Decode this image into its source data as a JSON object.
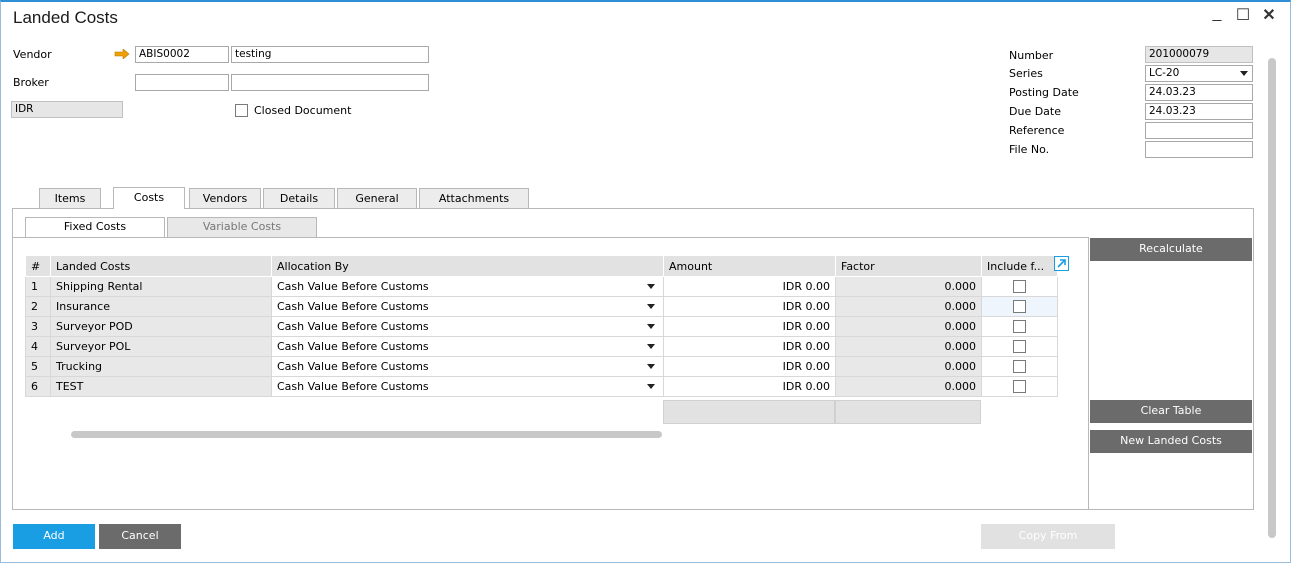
{
  "window": {
    "title": "Landed Costs",
    "minimize": "_",
    "maximize": "☐",
    "close": "✕"
  },
  "header": {
    "vendor_label": "Vendor",
    "vendor_code": "ABIS0002",
    "vendor_name": "testing",
    "broker_label": "Broker",
    "broker_code": "",
    "broker_name": "",
    "currency": "IDR",
    "closed_document_label": "Closed Document",
    "closed_document_checked": false
  },
  "right_fields": {
    "number_label": "Number",
    "number_value": "201000079",
    "series_label": "Series",
    "series_value": "LC-20",
    "posting_date_label": "Posting Date",
    "posting_date_value": "24.03.23",
    "due_date_label": "Due Date",
    "due_date_value": "24.03.23",
    "reference_label": "Reference",
    "reference_value": "",
    "file_no_label": "File No.",
    "file_no_value": ""
  },
  "tabs": [
    "Items",
    "Costs",
    "Vendors",
    "Details",
    "General",
    "Attachments"
  ],
  "active_tab": "Costs",
  "subtabs": [
    "Fixed Costs",
    "Variable Costs"
  ],
  "active_subtab": "Fixed Costs",
  "grid": {
    "headers": [
      "#",
      "Landed Costs",
      "Allocation By",
      "Amount",
      "Factor",
      "Include f..."
    ],
    "rows": [
      {
        "num": "1",
        "name": "Shipping Rental",
        "alloc": "Cash Value Before Customs",
        "amount": "IDR 0.00",
        "factor": "0.000",
        "include": false
      },
      {
        "num": "2",
        "name": "Insurance",
        "alloc": "Cash Value Before Customs",
        "amount": "IDR 0.00",
        "factor": "0.000",
        "include": false
      },
      {
        "num": "3",
        "name": "Surveyor POD",
        "alloc": "Cash Value Before Customs",
        "amount": "IDR 0.00",
        "factor": "0.000",
        "include": false
      },
      {
        "num": "4",
        "name": "Surveyor POL",
        "alloc": "Cash Value Before Customs",
        "amount": "IDR 0.00",
        "factor": "0.000",
        "include": false
      },
      {
        "num": "5",
        "name": "Trucking",
        "alloc": "Cash Value Before Customs",
        "amount": "IDR 0.00",
        "factor": "0.000",
        "include": false
      },
      {
        "num": "6",
        "name": "TEST",
        "alloc": "Cash Value Before Customs",
        "amount": "IDR 0.00",
        "factor": "0.000",
        "include": false
      }
    ]
  },
  "side_buttons": {
    "recalculate": "Recalculate",
    "clear_table": "Clear Table",
    "new_landed_costs": "New Landed Costs"
  },
  "footer": {
    "add": "Add",
    "cancel": "Cancel",
    "copy_from": "Copy From"
  },
  "colors": {
    "accent_blue": "#1a9ee3",
    "button_gray": "#6b6b6b",
    "vendor_arrow": "#f0a000"
  }
}
